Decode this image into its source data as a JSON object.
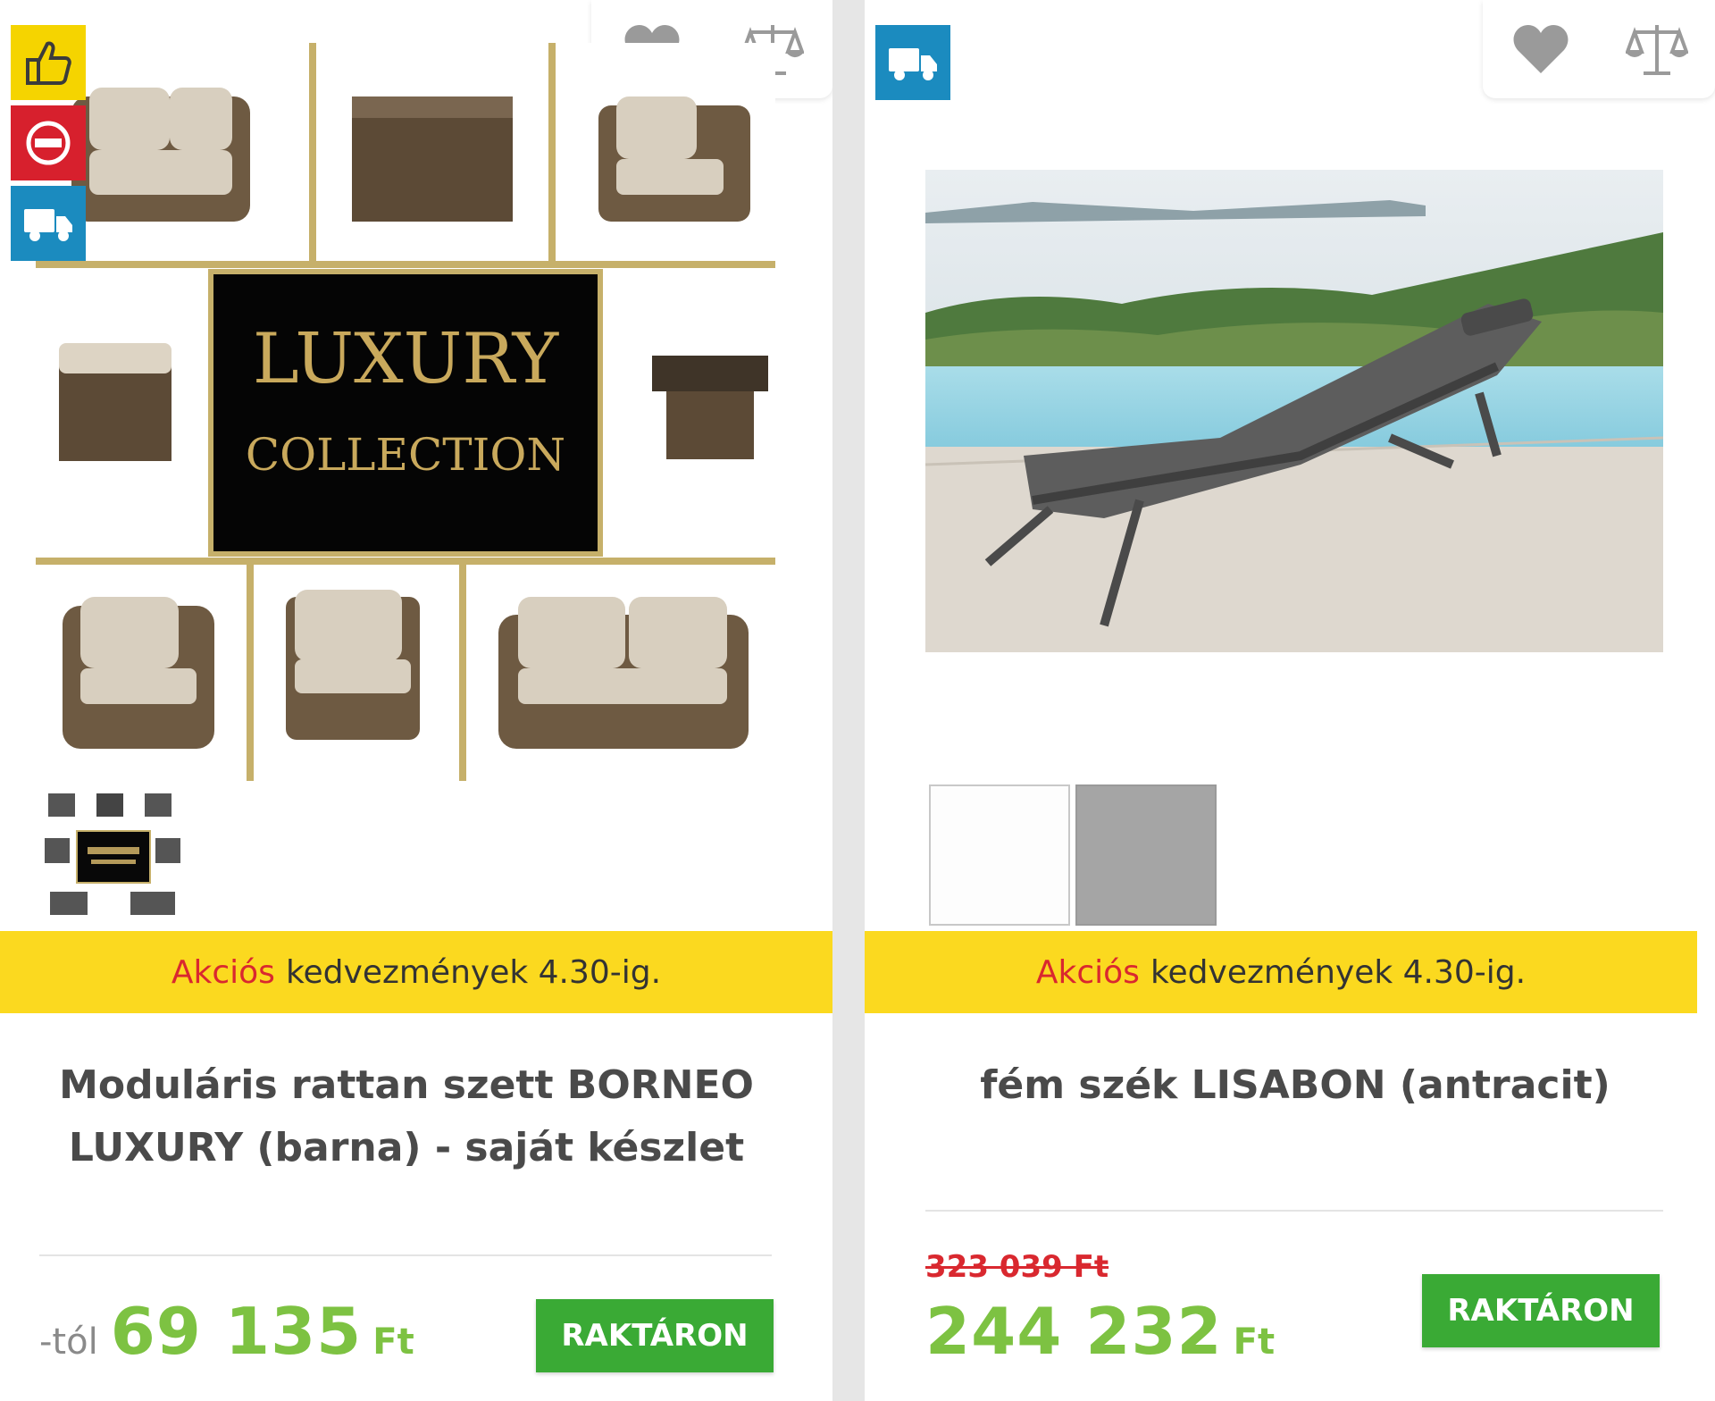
{
  "products": [
    {
      "image_text_1": "LUXURY",
      "image_text_2": "COLLECTION",
      "promo_highlight": "Akciós",
      "promo_text": "kedvezmények 4.30-ig.",
      "title": "Moduláris rattan szett BORNEO LUXURY (barna) - saját készlet",
      "price_prefix": "-tól",
      "price": "69 135",
      "currency": "Ft",
      "stock_label": "RAKTÁRON",
      "badges": [
        "thumbs-up-icon",
        "no-entry-icon",
        "truck-icon"
      ]
    },
    {
      "promo_highlight": "Akciós",
      "promo_text": "kedvezmények 4.30-ig.",
      "title": "fém szék LISABON (antracit)",
      "old_price": "323 039 Ft",
      "price": "244 232",
      "currency": "Ft",
      "stock_label": "RAKTÁRON",
      "badges": [
        "truck-icon"
      ],
      "swatches": [
        "#ffffff",
        "#a5a5a5"
      ]
    }
  ],
  "colors": {
    "promo_bg": "#fbd91f",
    "promo_highlight": "#d9282f",
    "price_green": "#7dc242",
    "button_green": "#3aaa35",
    "badge_yellow": "#f5d400",
    "badge_red": "#d7202d",
    "badge_blue": "#1b8bbf"
  }
}
